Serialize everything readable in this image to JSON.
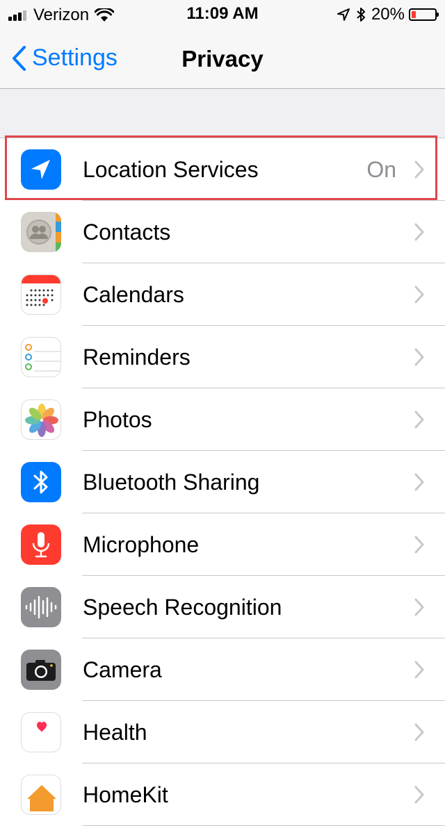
{
  "status_bar": {
    "carrier": "Verizon",
    "time": "11:09 AM",
    "battery_percent": "20%",
    "battery_level": 0.2,
    "icons": [
      "signal-icon",
      "wifi-icon",
      "location-arrow-icon",
      "bluetooth-icon",
      "battery-icon"
    ]
  },
  "nav": {
    "back_label": "Settings",
    "title": "Privacy"
  },
  "colors": {
    "accent": "#007aff",
    "highlight_border": "#e0464b",
    "battery_low": "#ff3b30"
  },
  "items": [
    {
      "label": "Location Services",
      "detail": "On",
      "icon": "location-services-icon"
    },
    {
      "label": "Contacts",
      "detail": "",
      "icon": "contacts-icon"
    },
    {
      "label": "Calendars",
      "detail": "",
      "icon": "calendar-icon"
    },
    {
      "label": "Reminders",
      "detail": "",
      "icon": "reminders-icon"
    },
    {
      "label": "Photos",
      "detail": "",
      "icon": "photos-icon"
    },
    {
      "label": "Bluetooth Sharing",
      "detail": "",
      "icon": "bluetooth-icon"
    },
    {
      "label": "Microphone",
      "detail": "",
      "icon": "microphone-icon"
    },
    {
      "label": "Speech Recognition",
      "detail": "",
      "icon": "speech-recognition-icon"
    },
    {
      "label": "Camera",
      "detail": "",
      "icon": "camera-icon"
    },
    {
      "label": "Health",
      "detail": "",
      "icon": "health-icon"
    },
    {
      "label": "HomeKit",
      "detail": "",
      "icon": "homekit-icon"
    }
  ]
}
